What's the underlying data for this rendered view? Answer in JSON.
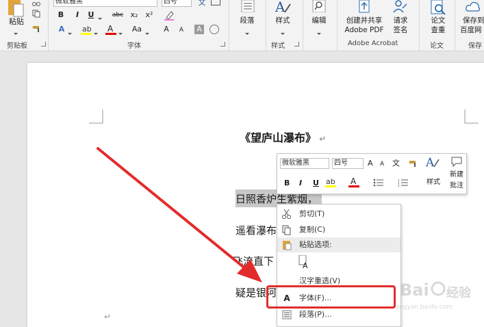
{
  "ribbon": {
    "clipboard": {
      "paste_label": "粘贴",
      "group_label": "剪贴板"
    },
    "font": {
      "font_name": "微软雅黑",
      "font_size": "四号",
      "bold": "B",
      "italic": "I",
      "underline": "U",
      "strike": "abc",
      "subscript": "x₂",
      "superscript": "x²",
      "grow": "A",
      "shrink": "A",
      "change_case": "Aa",
      "group_label": "字体"
    },
    "paragraph": {
      "label": "段落"
    },
    "styles": {
      "label": "样式",
      "group_label": "样式"
    },
    "editing": {
      "label": "编辑"
    },
    "acrobat": {
      "create_share_line1": "创建并共享",
      "create_share_line2": "Adobe PDF",
      "request_sign_line1": "请求",
      "request_sign_line2": "签名",
      "group_label": "Adobe Acrobat"
    },
    "paper": {
      "label_line1": "论文",
      "label_line2": "查重",
      "group_label": "论文"
    },
    "save": {
      "label_line1": "保存到",
      "label_line2": "百度网",
      "group_label": "保存"
    }
  },
  "document": {
    "title": "《望庐山瀑布》",
    "line1": "日照香炉生紫烟，",
    "line2": "遥看瀑布",
    "line3": "飞流直下",
    "line4": "疑是银河"
  },
  "mini_toolbar": {
    "font_name": "微软雅黑",
    "font_size": "四号",
    "bold": "B",
    "italic": "I",
    "underline": "U",
    "grow": "A",
    "shrink": "A",
    "styles_label": "样式",
    "new_comment_line1": "新建",
    "new_comment_line2": "批注"
  },
  "context_menu": {
    "cut": "剪切(T)",
    "copy": "复制(C)",
    "paste_options": "粘贴选项:",
    "hanzi_reselect": "汉字重选(V)",
    "font": "字体(F)...",
    "paragraph": "段落(P)..."
  },
  "watermark": {
    "brand": "Baidu",
    "word": "经验",
    "url": "jingyan.baidu.com"
  },
  "colors": {
    "highlight_yellow": "#ffff00",
    "font_red": "#e00000",
    "annotation_red": "#e32b2b",
    "selection_gray": "#c8c8c8"
  }
}
